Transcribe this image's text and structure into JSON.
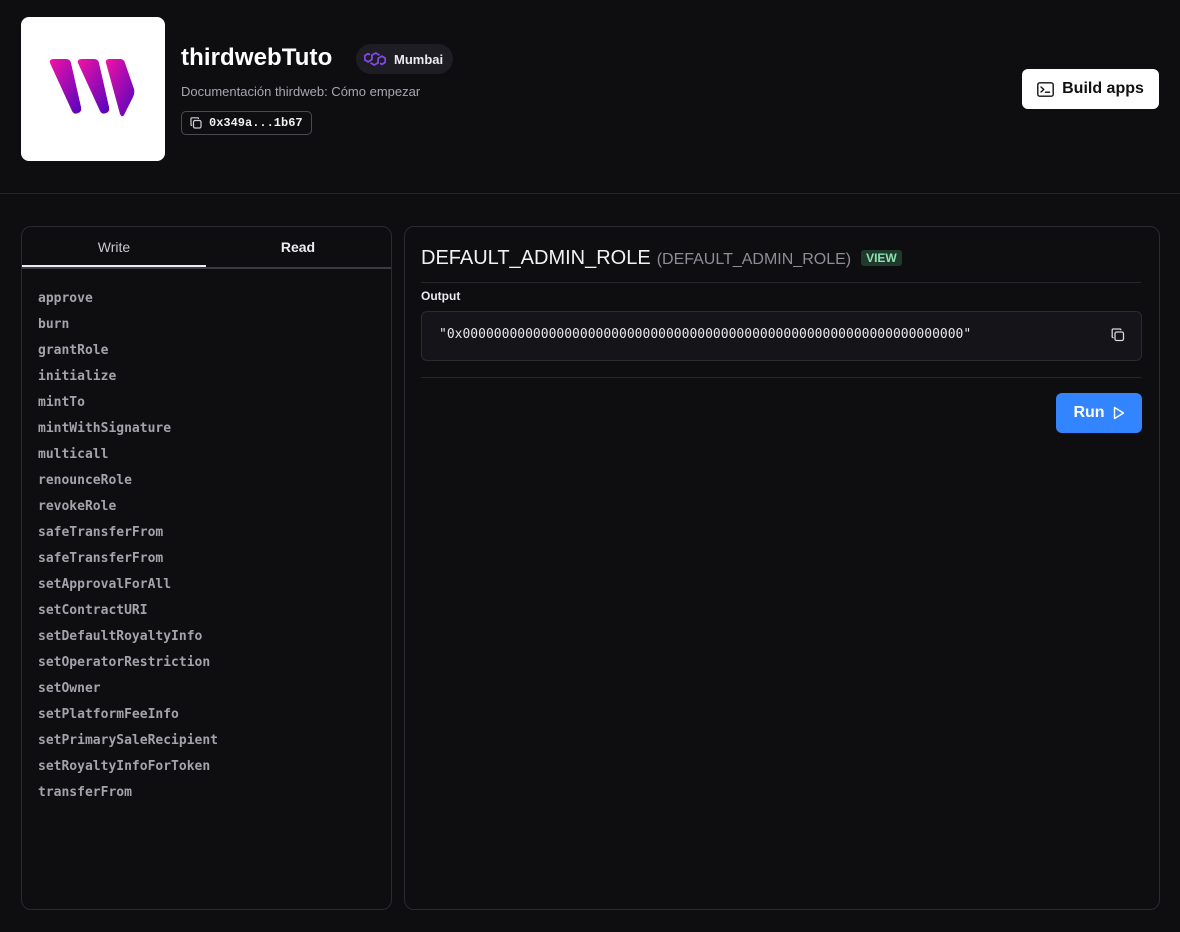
{
  "header": {
    "title": "thirdwebTuto",
    "chain": {
      "name": "Mumbai",
      "icon": "polygon-icon",
      "color": "#8247e5"
    },
    "subtitle": "Documentación thirdweb: Cómo empezar",
    "address": "0x349a...1b67",
    "build_apps_label": "Build apps"
  },
  "tabs": [
    {
      "label": "Write",
      "active": false
    },
    {
      "label": "Read",
      "active": true
    }
  ],
  "functions": [
    "approve",
    "burn",
    "grantRole",
    "initialize",
    "mintTo",
    "mintWithSignature",
    "multicall",
    "renounceRole",
    "revokeRole",
    "safeTransferFrom",
    "safeTransferFrom",
    "setApprovalForAll",
    "setContractURI",
    "setDefaultRoyaltyInfo",
    "setOperatorRestriction",
    "setOwner",
    "setPlatformFeeInfo",
    "setPrimarySaleRecipient",
    "setRoyaltyInfoForToken",
    "transferFrom"
  ],
  "detail": {
    "name": "DEFAULT_ADMIN_ROLE",
    "signature": "(DEFAULT_ADMIN_ROLE)",
    "badge": "VIEW",
    "output_label": "Output",
    "output_value": "\"0x0000000000000000000000000000000000000000000000000000000000000000\"",
    "run_label": "Run"
  },
  "colors": {
    "accent": "#3385ff",
    "view_badge_bg": "#1f3a2c",
    "view_badge_fg": "#8fe0b2"
  }
}
